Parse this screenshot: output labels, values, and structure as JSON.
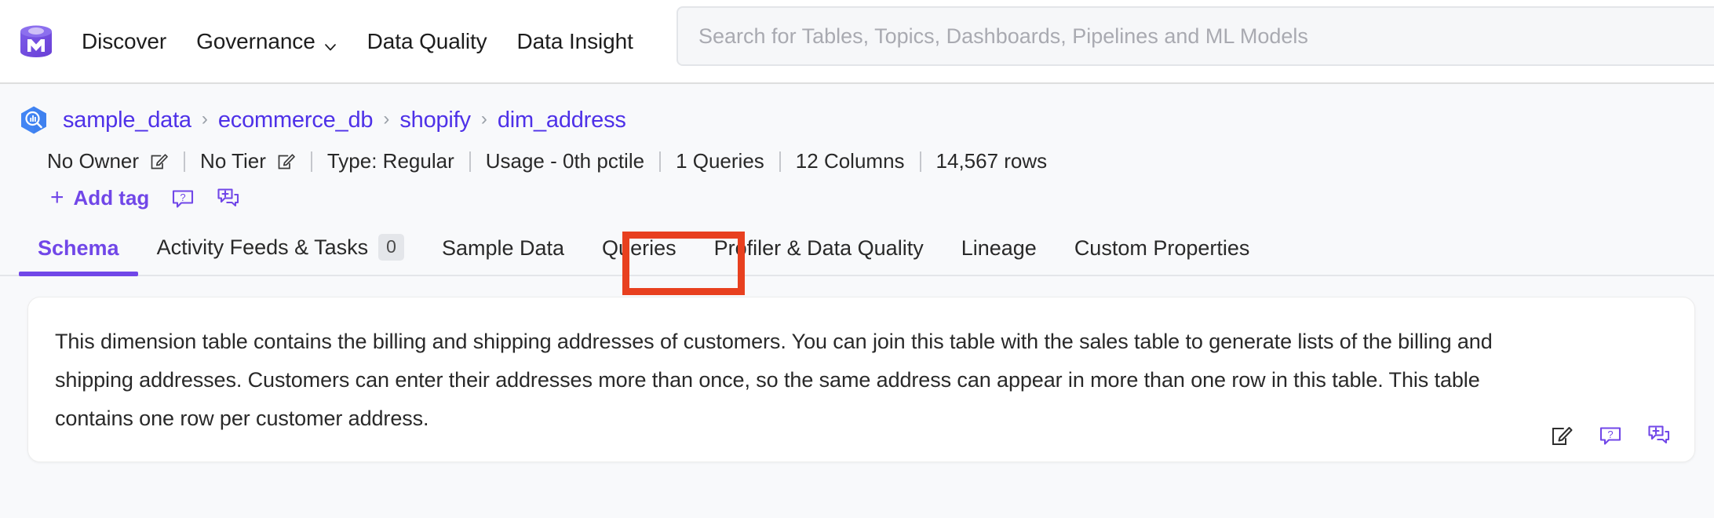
{
  "header": {
    "logo_name": "openmetadata-logo",
    "nav": [
      {
        "label": "Discover",
        "has_dropdown": false
      },
      {
        "label": "Governance",
        "has_dropdown": true
      },
      {
        "label": "Data Quality",
        "has_dropdown": false
      },
      {
        "label": "Data Insight",
        "has_dropdown": false
      }
    ],
    "search": {
      "value": "",
      "placeholder": "Search for Tables, Topics, Dashboards, Pipelines and ML Models"
    }
  },
  "entity": {
    "service_icon": "bigquery-icon",
    "breadcrumb": [
      {
        "label": "sample_data"
      },
      {
        "label": "ecommerce_db"
      },
      {
        "label": "shopify"
      },
      {
        "label": "dim_address"
      }
    ],
    "breadcrumb_separator": "›",
    "meta": [
      {
        "label": "No Owner",
        "edit": true
      },
      {
        "label": "No Tier",
        "edit": true
      },
      {
        "label": "Type:  Regular",
        "edit": false
      },
      {
        "label": "Usage - 0th pctile",
        "edit": false
      },
      {
        "label": "1 Queries",
        "edit": false
      },
      {
        "label": "12 Columns",
        "edit": false
      },
      {
        "label": "14,567 rows",
        "edit": false
      }
    ],
    "add_tag_label": "Add tag",
    "add_tag_plus": "+",
    "help_icon_name": "help-bubble-icon",
    "comment_icon_name": "add-comment-icon"
  },
  "tabs": [
    {
      "label": "Schema",
      "active": true,
      "count": null
    },
    {
      "label": "Activity Feeds & Tasks",
      "active": false,
      "count": "0"
    },
    {
      "label": "Sample Data",
      "active": false,
      "count": null
    },
    {
      "label": "Queries",
      "active": false,
      "count": null
    },
    {
      "label": "Profiler & Data Quality",
      "active": false,
      "count": null
    },
    {
      "label": "Lineage",
      "active": false,
      "count": null
    },
    {
      "label": "Custom Properties",
      "active": false,
      "count": null
    }
  ],
  "annotation": {
    "target_tab": "Queries",
    "color": "#E8401F"
  },
  "description": {
    "text": "This dimension table contains the billing and shipping addresses of customers. You can join this table with the sales table to generate lists of the billing and shipping addresses. Customers can enter their addresses more than once, so the same address can appear in more than one row in this table. This table contains one row per customer address.",
    "actions": [
      {
        "icon": "edit-icon"
      },
      {
        "icon": "help-bubble-icon"
      },
      {
        "icon": "add-comment-icon"
      }
    ]
  },
  "colors": {
    "accent_purple": "#7147E8",
    "link_purple": "#4E31E8",
    "annotation_red": "#E8401F",
    "page_bg": "#F8F9FB"
  }
}
